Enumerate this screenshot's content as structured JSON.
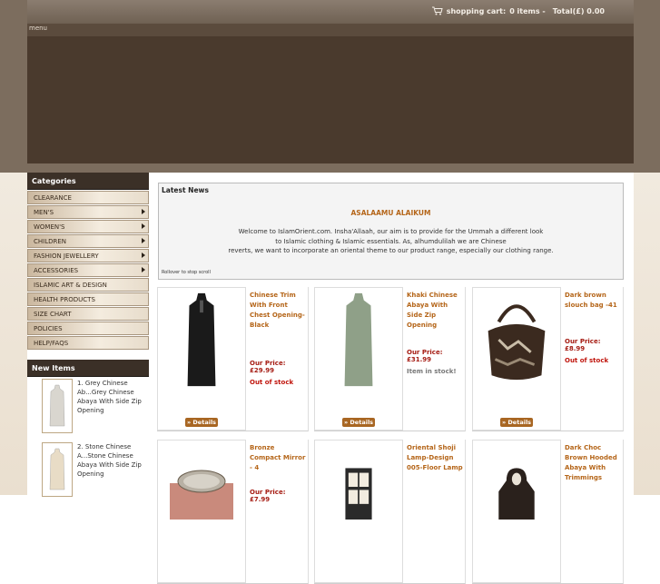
{
  "header": {
    "menu_label": "menu",
    "cart_label": "shopping cart:",
    "cart_items": "0  items -",
    "cart_total": "Total(£) 0.00"
  },
  "sidebar": {
    "categories_title": "Categories",
    "categories": [
      {
        "label": "CLEARANCE",
        "has_sub": false
      },
      {
        "label": "MEN'S",
        "has_sub": true
      },
      {
        "label": "WOMEN'S",
        "has_sub": true
      },
      {
        "label": "CHILDREN",
        "has_sub": true
      },
      {
        "label": "FASHION JEWELLERY",
        "has_sub": true
      },
      {
        "label": "ACCESSORIES",
        "has_sub": true
      },
      {
        "label": "ISLAMIC ART & DESIGN",
        "has_sub": false
      },
      {
        "label": "HEALTH PRODUCTS",
        "has_sub": false
      },
      {
        "label": "SIZE CHART",
        "has_sub": false
      },
      {
        "label": "POLICIES",
        "has_sub": false
      },
      {
        "label": "HELP/FAQS",
        "has_sub": false
      }
    ],
    "new_items_title": "New Items",
    "new_items": [
      {
        "text": "1. Grey Chinese Ab...Grey Chinese Abaya With Side Zip Opening"
      },
      {
        "text": "2. Stone Chinese A...Stone Chinese Abaya With Side Zip Opening"
      }
    ]
  },
  "news": {
    "title": "Latest News",
    "greeting": "ASALAAMU ALAIKUM",
    "line1": "Welcome to IslamOrient.com. Insha'Allaah, our aim is to provide for the Ummah a different look",
    "line2": "to Islamic clothing & Islamic essentials. As, alhumdulilah we are Chinese",
    "line3": "reverts, we want to incorporate an oriental theme to our product range, especially our clothing range.",
    "footer": "Rollover to stop scroll"
  },
  "products": [
    {
      "name": "Chinese Trim With Front Chest Opening-Black",
      "price": "Our Price: £29.99",
      "stock": "Out of stock",
      "in_stock": false,
      "button": "» Details",
      "icon": "black-abaya-icon",
      "color": "#1a1a1a"
    },
    {
      "name": "Khaki Chinese Abaya With Side Zip Opening",
      "price": "Our Price: £31.99",
      "stock": "Item in stock!",
      "in_stock": true,
      "button": "» Details",
      "icon": "khaki-abaya-icon",
      "color": "#8fa088"
    },
    {
      "name": "Dark brown slouch bag -41",
      "price": "Our Price: £8.99",
      "stock": "Out of stock",
      "in_stock": false,
      "button": "» Details",
      "icon": "handbag-icon",
      "color": "#3b2a1f"
    },
    {
      "name": "Bronze Compact Mirror - 4",
      "price": "Our Price: £7.99",
      "stock": "",
      "in_stock": false,
      "button": "",
      "icon": "compact-mirror-icon",
      "color": "#c98a7c"
    },
    {
      "name": "Oriental Shoji Lamp-Design 005-Floor Lamp",
      "price": "",
      "stock": "",
      "in_stock": false,
      "button": "",
      "icon": "shoji-lamp-icon",
      "color": "#2a2a2a"
    },
    {
      "name": "Dark Choc Brown Hooded Abaya With Trimmings",
      "price": "",
      "stock": "",
      "in_stock": false,
      "button": "",
      "icon": "hooded-abaya-icon",
      "color": "#2a211c"
    }
  ],
  "colors": {
    "banner": "#4a3a2d",
    "accent": "#b5661a",
    "price": "#a51b12"
  }
}
